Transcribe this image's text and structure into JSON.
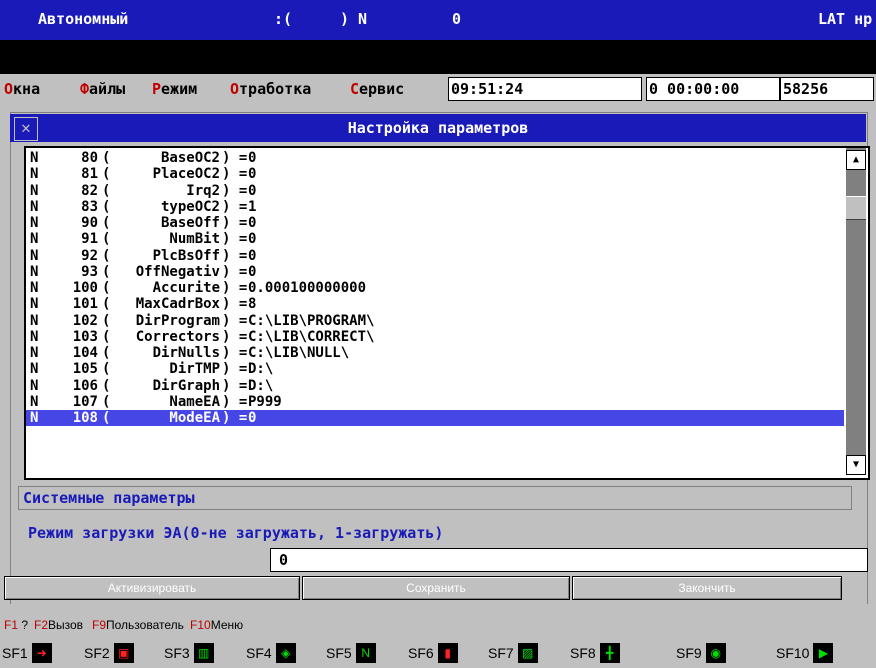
{
  "topbar": {
    "mode": "Автономный",
    "smile": ":(",
    "axis": ") N",
    "zero": "0",
    "right": "LAT нр"
  },
  "menu": {
    "items": [
      {
        "hot": "О",
        "rest": "кна"
      },
      {
        "hot": "Ф",
        "rest": "айлы"
      },
      {
        "hot": "Р",
        "rest": "ежим"
      },
      {
        "hot": "О",
        "rest": "тработка"
      },
      {
        "hot": "С",
        "rest": "ервис"
      }
    ],
    "clock": "09:51:24",
    "timer": "0 00:00:00",
    "counter": "58256"
  },
  "dialog": {
    "title": "Настройка параметров",
    "close_symbol": "✕"
  },
  "params": [
    {
      "flag": "N",
      "num": "80",
      "name": "BaseOC2",
      "value": "0"
    },
    {
      "flag": "N",
      "num": "81",
      "name": "PlaceOC2",
      "value": "0"
    },
    {
      "flag": "N",
      "num": "82",
      "name": "Irq2",
      "value": "0"
    },
    {
      "flag": "N",
      "num": "83",
      "name": "typeOC2",
      "value": "1"
    },
    {
      "flag": "N",
      "num": "90",
      "name": "BaseOff",
      "value": "0"
    },
    {
      "flag": "N",
      "num": "91",
      "name": "NumBit",
      "value": "0"
    },
    {
      "flag": "N",
      "num": "92",
      "name": "PlcBsOff",
      "value": "0"
    },
    {
      "flag": "N",
      "num": "93",
      "name": "OffNegativ",
      "value": "0"
    },
    {
      "flag": "N",
      "num": "100",
      "name": "Accurite",
      "value": "0.000100000000"
    },
    {
      "flag": "N",
      "num": "101",
      "name": "MaxCadrBox",
      "value": "8"
    },
    {
      "flag": "N",
      "num": "102",
      "name": "DirProgram",
      "value": "C:\\LIB\\PROGRAM\\"
    },
    {
      "flag": "N",
      "num": "103",
      "name": "Correctors",
      "value": "C:\\LIB\\CORRECT\\"
    },
    {
      "flag": "N",
      "num": "104",
      "name": "DirNulls",
      "value": "C:\\LIB\\NULL\\"
    },
    {
      "flag": "N",
      "num": "105",
      "name": "DirTMP",
      "value": "D:\\"
    },
    {
      "flag": "N",
      "num": "106",
      "name": "DirGraph",
      "value": "D:\\"
    },
    {
      "flag": "N",
      "num": "107",
      "name": "NameEA",
      "value": "P999"
    },
    {
      "flag": "N",
      "num": "108",
      "name": "ModeEA",
      "value": "0"
    }
  ],
  "selected_index": 16,
  "syntax": {
    "open": "(",
    "close": ")",
    "eq": "="
  },
  "scroll": {
    "up": "▲",
    "down": "▼"
  },
  "section_label": "Системные параметры",
  "hint": "Режим загрузки ЭА(0-не загружать, 1-загружать)",
  "edit_value": "0",
  "buttons": {
    "activate": "Активизировать",
    "save": "Сохранить",
    "finish": "Закончить"
  },
  "fkeys": [
    {
      "key": "F1",
      "text": " ?"
    },
    {
      "key": "F2",
      "text": "Вызов"
    },
    {
      "key": "F9",
      "text": "Пользователь"
    },
    {
      "key": "F10",
      "text": "Меню"
    }
  ],
  "sf_keys": [
    {
      "label": "SF1",
      "icon": "arrow-right-icon",
      "glyph": "➜",
      "red": true
    },
    {
      "label": "SF2",
      "icon": "window-icon",
      "glyph": "▣",
      "red": true
    },
    {
      "label": "SF3",
      "icon": "chart-icon",
      "glyph": "▥",
      "red": false
    },
    {
      "label": "SF4",
      "icon": "diamond-icon",
      "glyph": "◈",
      "red": false
    },
    {
      "label": "SF5",
      "icon": "n-box-icon",
      "glyph": "N",
      "red": false
    },
    {
      "label": "SF6",
      "icon": "stop-icon",
      "glyph": "▮",
      "red": true
    },
    {
      "label": "SF7",
      "icon": "edit-icon",
      "glyph": "▨",
      "red": false
    },
    {
      "label": "SF8",
      "icon": "crosshair-icon",
      "glyph": "╋",
      "red": false
    },
    {
      "label": "SF9",
      "icon": "circle-icon",
      "glyph": "◉",
      "red": false
    },
    {
      "label": "SF10",
      "icon": "play-icon",
      "glyph": "▶",
      "red": false
    }
  ]
}
